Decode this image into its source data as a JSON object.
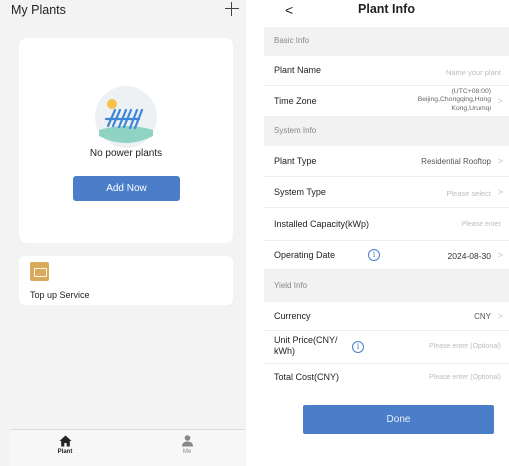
{
  "left": {
    "title": "My Plants",
    "empty_text": "No power plants",
    "add_button": "Add Now",
    "service_label": "Top up Service",
    "tabs": [
      {
        "label": "Plant",
        "icon": "house-icon"
      },
      {
        "label": "Me",
        "icon": "person-icon"
      }
    ]
  },
  "right": {
    "back": "<",
    "title": "Plant Info",
    "sections": {
      "basic": "Basic Info",
      "system": "System Info",
      "yield": "Yield Info"
    },
    "fields": {
      "plant_name": {
        "label": "Plant Name",
        "placeholder": "Name your plant"
      },
      "time_zone": {
        "label": "Time Zone",
        "value_line1": "(UTC+08:00)",
        "value_line2": "Beijing,Chongqing,Hong",
        "value_line3": "Kong,Urumqi"
      },
      "plant_type": {
        "label": "Plant Type",
        "value": "Residential Rooftop"
      },
      "system_type": {
        "label": "System Type",
        "placeholder": "Please select"
      },
      "installed_capacity": {
        "label": "Installed Capacity(kWp)",
        "placeholder": "Please enter"
      },
      "operating_date": {
        "label": "Operating Date",
        "value": "2024-08-30"
      },
      "currency": {
        "label": "Currency",
        "value": "CNY"
      },
      "unit_price": {
        "label_line1": "Unit Price(CNY/",
        "label_line2": "kWh)",
        "placeholder": "Please enter (Optional)"
      },
      "total_cost": {
        "label": "Total Cost(CNY)",
        "placeholder": "Please enter (Optional)"
      }
    },
    "done_button": "Done",
    "info_glyph": "i",
    "chevron": ">"
  },
  "colors": {
    "accent": "#4a7ec9",
    "service_icon": "#d9a95c",
    "section_bg": "#f2f2f2",
    "page_bg": "#f3f3f3"
  }
}
